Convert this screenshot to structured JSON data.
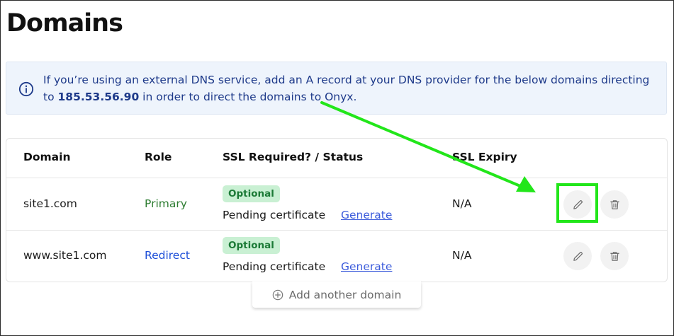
{
  "page": {
    "title": "Domains"
  },
  "banner": {
    "text_before": "If you’re using an external DNS service, add an A record at your DNS provider for the below domains directing to ",
    "ip": "185.53.56.90",
    "text_after": " in order to direct the domains to Onyx.",
    "icon": "info-circle-icon",
    "color": "#1e3a8a"
  },
  "table": {
    "headers": {
      "domain": "Domain",
      "role": "Role",
      "ssl": "SSL Required? / Status",
      "expiry": "SSL Expiry"
    },
    "rows": [
      {
        "domain": "site1.com",
        "role": "Primary",
        "badge": "Optional",
        "status": "Pending certificate",
        "action": "Generate",
        "expiry": "N/A"
      },
      {
        "domain": "www.site1.com",
        "role": "Redirect",
        "badge": "Optional",
        "status": "Pending certificate",
        "action": "Generate",
        "expiry": "N/A"
      }
    ]
  },
  "add_domain": {
    "label": "Add another domain",
    "icon": "plus-circle-icon"
  },
  "annotation": {
    "color": "#22e61a"
  }
}
